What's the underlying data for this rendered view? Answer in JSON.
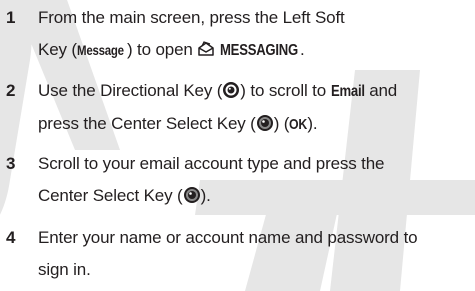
{
  "watermark": "DRAFT",
  "steps": [
    {
      "number": "1",
      "line1_a": "From the main screen, press the Left Soft",
      "line2_a": "Key (",
      "line2_key": "Message",
      "line2_b": ") to open ",
      "line2_menu": "MESSAGING",
      "line2_c": ".",
      "icon": "messaging-envelope-icon"
    },
    {
      "number": "2",
      "line1_a": "Use the Directional Key (",
      "line1_b": ") to scroll to ",
      "line1_item": "Email",
      "line1_c": " and",
      "line2_a": "press the Center Select Key (",
      "line2_b": ") (",
      "line2_key": "OK",
      "line2_c": ").",
      "icons": [
        "directional-key-icon",
        "center-select-key-icon"
      ]
    },
    {
      "number": "3",
      "line1": "Scroll to your email account type and press the",
      "line2_a": "Center Select Key (",
      "line2_b": ").",
      "icon": "center-select-key-icon"
    },
    {
      "number": "4",
      "line1": "Enter your name or account name and password to",
      "line2": "sign in."
    }
  ]
}
